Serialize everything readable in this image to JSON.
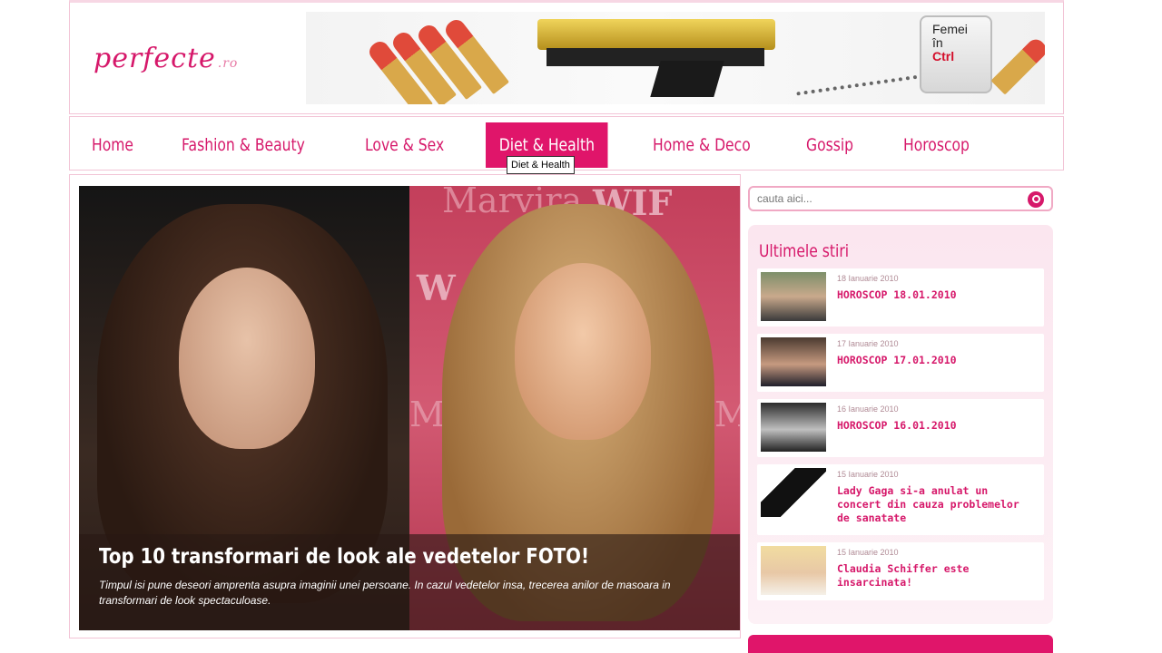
{
  "site": {
    "logo_text": "perfecte",
    "logo_suffix": ".ro",
    "banner_key_lines": [
      "Femei",
      "în",
      "Ctrl"
    ]
  },
  "nav": {
    "items": [
      {
        "label": "Home"
      },
      {
        "label": "Fashion & Beauty"
      },
      {
        "label": "Love & Sex"
      },
      {
        "label": "Diet & Health"
      },
      {
        "label": "Home & Deco"
      },
      {
        "label": "Gossip"
      },
      {
        "label": "Horoscop"
      }
    ],
    "active": "Diet & Health",
    "tooltip": "Diet & Health"
  },
  "hero": {
    "title": "Top 10 transformari de look ale vedetelor FOTO!",
    "text": "Timpul isi pune deseori amprenta asupra imaginii unei persoane. In cazul vedetelor insa, trecerea anilor de masoara in transformari de look spectaculoase.",
    "bg_words": [
      "Marvira",
      "WIF",
      "W",
      "Ma",
      "M"
    ]
  },
  "search": {
    "placeholder": "cauta aici..."
  },
  "news": {
    "title": "Ultimele stiri",
    "items": [
      {
        "date": "18 Ianuarie 2010",
        "title": "HOROSCOP 18.01.2010"
      },
      {
        "date": "17 Ianuarie 2010",
        "title": "HOROSCOP 17.01.2010"
      },
      {
        "date": "16 Ianuarie 2010",
        "title": "HOROSCOP 16.01.2010"
      },
      {
        "date": "15 Ianuarie 2010",
        "title": "Lady Gaga si-a anulat un concert din cauza problemelor de sanatate"
      },
      {
        "date": "15 Ianuarie 2010",
        "title": "Claudia Schiffer este insarcinata!"
      }
    ]
  },
  "colors": {
    "accent": "#d6186a",
    "accent_bg": "#e0156a",
    "border": "#f2c4d6"
  }
}
